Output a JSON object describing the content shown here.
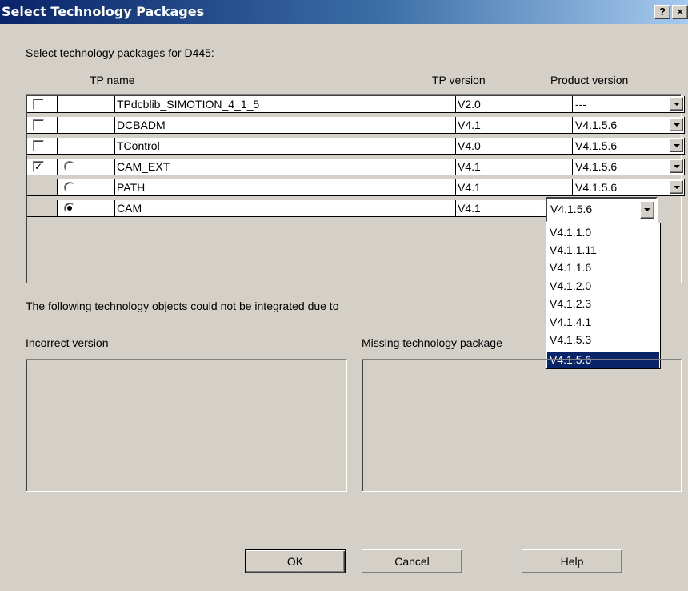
{
  "window": {
    "title": "Select Technology Packages",
    "help_button": "?",
    "close_button": "×"
  },
  "instruction": "Select technology packages for D445:",
  "columns": {
    "name": "TP name",
    "tp_version": "TP version",
    "product_version": "Product version"
  },
  "rows": [
    {
      "checkbox": "unchecked",
      "radio": "none",
      "name": "TPdcblib_SIMOTION_4_1_5",
      "tp_version": "V2.0",
      "product_version": "---"
    },
    {
      "checkbox": "unchecked",
      "radio": "none",
      "name": "DCBADM",
      "tp_version": "V4.1",
      "product_version": "V4.1.5.6"
    },
    {
      "checkbox": "unchecked",
      "radio": "none",
      "name": "TControl",
      "tp_version": "V4.0",
      "product_version": "V4.1.5.6"
    },
    {
      "checkbox": "checked",
      "radio": "unselected",
      "name": "CAM_EXT",
      "tp_version": "V4.1",
      "product_version": "V4.1.5.6"
    },
    {
      "checkbox": "none",
      "radio": "unselected",
      "name": "PATH",
      "tp_version": "V4.1",
      "product_version": "V4.1.5.6"
    },
    {
      "checkbox": "none",
      "radio": "selected",
      "name": "CAM",
      "tp_version": "V4.1",
      "product_version": "V4.1.5.6"
    }
  ],
  "dropdown": {
    "options": [
      "V4.1.1.0",
      "V4.1.1.11",
      "V4.1.1.6",
      "V4.1.2.0",
      "V4.1.2.3",
      "V4.1.4.1",
      "V4.1.5.3",
      "V4.1.5.6"
    ],
    "selected": "V4.1.5.6"
  },
  "info_text": "The following technology objects could not be integrated due to",
  "incorrect_version_label": "Incorrect version",
  "missing_package_label": "Missing technology package",
  "buttons": {
    "ok": "OK",
    "cancel": "Cancel",
    "help": "Help"
  },
  "colors": {
    "title_bar": "#0a246a",
    "selection": "#0a246a",
    "dialog_face": "#d4d0c8"
  }
}
